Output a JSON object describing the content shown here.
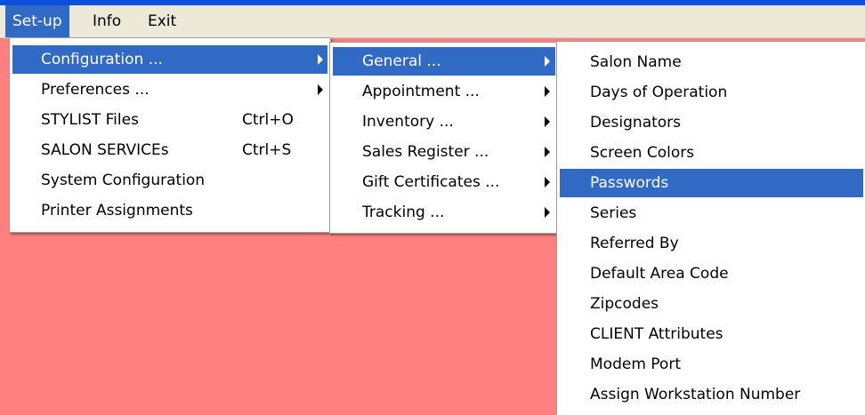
{
  "menubar": {
    "items": [
      {
        "label": "Set-up"
      },
      {
        "label": "Info"
      },
      {
        "label": "Exit"
      }
    ]
  },
  "setup_menu": {
    "items": [
      {
        "label": "Configuration ...",
        "shortcut": "",
        "submenu": true
      },
      {
        "label": "Preferences ...",
        "shortcut": "",
        "submenu": true
      },
      {
        "label": "STYLIST Files",
        "shortcut": "Ctrl+O",
        "submenu": false
      },
      {
        "label": "SALON SERVICEs",
        "shortcut": "Ctrl+S",
        "submenu": false
      },
      {
        "label": "System Configuration",
        "shortcut": "",
        "submenu": false
      },
      {
        "label": "Printer Assignments",
        "shortcut": "",
        "submenu": false
      }
    ]
  },
  "configuration_menu": {
    "items": [
      {
        "label": "General ..."
      },
      {
        "label": "Appointment ..."
      },
      {
        "label": "Inventory ..."
      },
      {
        "label": "Sales Register ..."
      },
      {
        "label": "Gift Certificates ..."
      },
      {
        "label": "Tracking ..."
      }
    ]
  },
  "general_menu": {
    "items": [
      {
        "label": "Salon Name"
      },
      {
        "label": "Days of Operation"
      },
      {
        "label": "Designators"
      },
      {
        "label": "Screen Colors"
      },
      {
        "label": "Passwords"
      },
      {
        "label": "Series"
      },
      {
        "label": "Referred By"
      },
      {
        "label": "Default Area Code"
      },
      {
        "label": "Zipcodes"
      },
      {
        "label": "CLIENT Attributes"
      },
      {
        "label": "Modem Port"
      },
      {
        "label": "Assign Workstation Number"
      }
    ]
  },
  "colors": {
    "selection": "#316ac5",
    "background": "#fd7f7f",
    "menubar": "#ece9d8",
    "title_strip": "#0a50dc"
  }
}
